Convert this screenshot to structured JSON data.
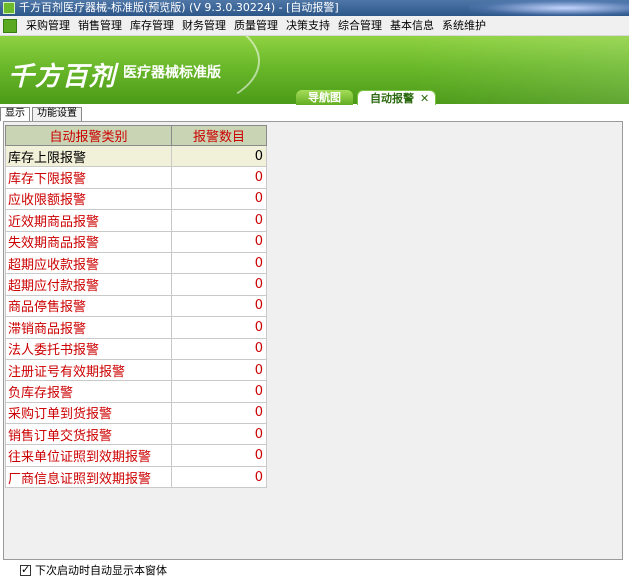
{
  "window": {
    "title": "千方百剂医疗器械-标准版(预览版) (V 9.3.0.30224) - [自动报警]"
  },
  "menu": [
    "采购管理",
    "销售管理",
    "库存管理",
    "财务管理",
    "质量管理",
    "决策支持",
    "综合管理",
    "基本信息",
    "系统维护"
  ],
  "banner": {
    "logo": "千方百剂",
    "product": "医疗器械标准版"
  },
  "tabs": {
    "nav": "导航图",
    "active": "自动报警"
  },
  "subtabs": [
    "显示",
    "功能设置"
  ],
  "table": {
    "headers": [
      "自动报警类别",
      "报警数目"
    ],
    "rows": [
      {
        "category": "库存上限报警",
        "count": "0"
      },
      {
        "category": "库存下限报警",
        "count": "0"
      },
      {
        "category": "应收限额报警",
        "count": "0"
      },
      {
        "category": "近效期商品报警",
        "count": "0"
      },
      {
        "category": "失效期商品报警",
        "count": "0"
      },
      {
        "category": "超期应收款报警",
        "count": "0"
      },
      {
        "category": "超期应付款报警",
        "count": "0"
      },
      {
        "category": "商品停售报警",
        "count": "0"
      },
      {
        "category": "滞销商品报警",
        "count": "0"
      },
      {
        "category": "法人委托书报警",
        "count": "0"
      },
      {
        "category": "注册证号有效期报警",
        "count": "0"
      },
      {
        "category": "负库存报警",
        "count": "0"
      },
      {
        "category": "采购订单到货报警",
        "count": "0"
      },
      {
        "category": "销售订单交货报警",
        "count": "0"
      },
      {
        "category": "往来单位证照到效期报警",
        "count": "0"
      },
      {
        "category": "厂商信息证照到效期报警",
        "count": "0"
      }
    ]
  },
  "footer": {
    "checkbox_label": "下次启动时自动显示本窗体",
    "checked": true
  }
}
